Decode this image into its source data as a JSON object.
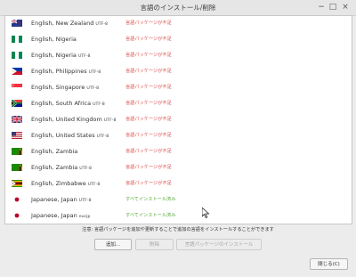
{
  "window": {
    "title": "言語のインストール/削除",
    "minimize_label": "−",
    "maximize_label": "□",
    "close_label": "×"
  },
  "languages": [
    {
      "name": "English, New Zealand",
      "encoding": "UTF-8",
      "status": "言語パッケージが不足",
      "status_type": "missing",
      "flag": "nz"
    },
    {
      "name": "English, Nigeria",
      "encoding": "",
      "status": "言語パッケージが不足",
      "status_type": "missing",
      "flag": "ng"
    },
    {
      "name": "English, Nigeria",
      "encoding": "UTF-8",
      "status": "言語パッケージが不足",
      "status_type": "missing",
      "flag": "ng"
    },
    {
      "name": "English, Philippines",
      "encoding": "UTF-8",
      "status": "言語パッケージが不足",
      "status_type": "missing",
      "flag": "ph"
    },
    {
      "name": "English, Singapore",
      "encoding": "UTF-8",
      "status": "言語パッケージが不足",
      "status_type": "missing",
      "flag": "sg"
    },
    {
      "name": "English, South Africa",
      "encoding": "UTF-8",
      "status": "言語パッケージが不足",
      "status_type": "missing",
      "flag": "za"
    },
    {
      "name": "English, United Kingdom",
      "encoding": "UTF-8",
      "status": "言語パッケージが不足",
      "status_type": "missing",
      "flag": "gb"
    },
    {
      "name": "English, United States",
      "encoding": "UTF-8",
      "status": "言語パッケージが不足",
      "status_type": "missing",
      "flag": "us"
    },
    {
      "name": "English, Zambia",
      "encoding": "",
      "status": "言語パッケージが不足",
      "status_type": "missing",
      "flag": "zm"
    },
    {
      "name": "English, Zambia",
      "encoding": "UTF-8",
      "status": "言語パッケージが不足",
      "status_type": "missing",
      "flag": "zm"
    },
    {
      "name": "English, Zimbabwe",
      "encoding": "UTF-8",
      "status": "言語パッケージが不足",
      "status_type": "missing",
      "flag": "zw"
    },
    {
      "name": "Japanese, Japan",
      "encoding": "UTF-8",
      "status": "すべてインストール済み",
      "status_type": "done",
      "flag": "jp"
    },
    {
      "name": "Japanese, Japan",
      "encoding": "eucjp",
      "status": "すべてインストール済み",
      "status_type": "done",
      "flag": "jp"
    }
  ],
  "note": "注意: 言語パッケージを追加や更新することで追加の言語をインストールすることができます",
  "buttons": {
    "add": "追加...",
    "remove": "削除",
    "install_packages": "言語パッケージのインストール",
    "close": "閉じる(C)"
  },
  "colors": {
    "missing": "#d9534f",
    "installed": "#5aaa3a"
  }
}
